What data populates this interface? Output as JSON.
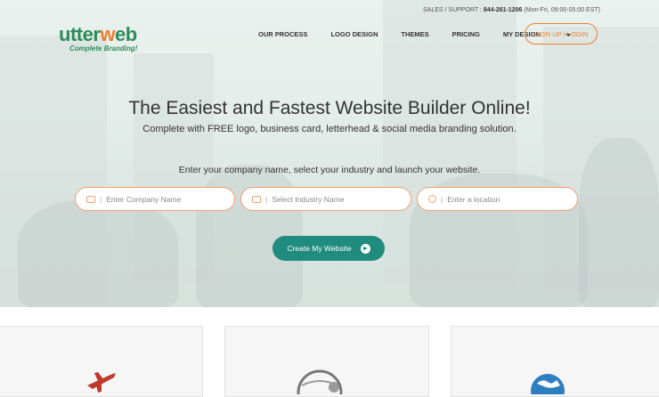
{
  "topbar": {
    "label": "SALES / SUPPORT :",
    "phone": "844-261-1206",
    "hours": "(Mon-Fri, 09:00-05:00 EST)"
  },
  "logo": {
    "name_part1": "utter",
    "name_o": "w",
    "name_part2": "eb",
    "tagline": "Complete Branding!"
  },
  "nav": {
    "items": [
      "OUR PROCESS",
      "LOGO DESIGN",
      "THEMES",
      "PRICING"
    ],
    "my_design": "MY DESIGN",
    "signup": "SIGN UP / LOGIN"
  },
  "hero": {
    "headline": "The Easiest and Fastest Website Builder Online!",
    "subline": "Complete with FREE logo, business card, letterhead & social media branding solution.",
    "prompt": "Enter your company name, select your industry and launch your website."
  },
  "form": {
    "company_placeholder": "Enter Company Name",
    "industry_placeholder": "Select Industry Name",
    "location_placeholder": "Enter a location",
    "submit_label": "Create My Website"
  },
  "colors": {
    "brand_green": "#2e8b5a",
    "accent_orange": "#f07c2a",
    "cta_teal": "#1f8c7e"
  },
  "icons": [
    "briefcase-icon",
    "briefcase-icon",
    "globe-icon",
    "arrow-right-circle-icon",
    "airplane-icon",
    "globe-grid-icon",
    "world-globe-icon"
  ]
}
